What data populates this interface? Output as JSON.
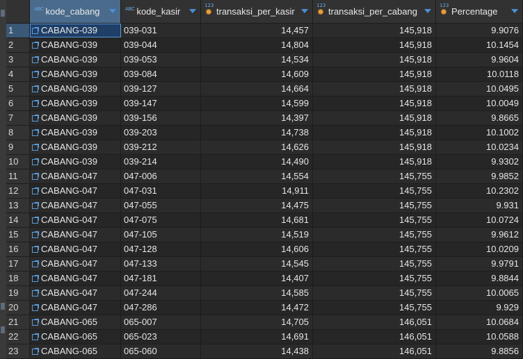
{
  "columns": [
    {
      "label": "kode_cabang",
      "type_icon": "abc-text-icon"
    },
    {
      "label": "kode_kasir",
      "type_icon": "abc-text-icon"
    },
    {
      "label": "transaksi_per_kasir",
      "type_icon": "123-number-icon"
    },
    {
      "label": "transaksi_per_cabang",
      "type_icon": "123-number-icon"
    },
    {
      "label": "Percentage",
      "type_icon": "123-number-icon"
    }
  ],
  "rows": [
    {
      "n": "1",
      "cabang": "CABANG-039",
      "kasir": "039-031",
      "tpk": "14,457",
      "tpc": "145,918",
      "pct": "9.9076"
    },
    {
      "n": "2",
      "cabang": "CABANG-039",
      "kasir": "039-044",
      "tpk": "14,804",
      "tpc": "145,918",
      "pct": "10.1454"
    },
    {
      "n": "3",
      "cabang": "CABANG-039",
      "kasir": "039-053",
      "tpk": "14,534",
      "tpc": "145,918",
      "pct": "9.9604"
    },
    {
      "n": "4",
      "cabang": "CABANG-039",
      "kasir": "039-084",
      "tpk": "14,609",
      "tpc": "145,918",
      "pct": "10.0118"
    },
    {
      "n": "5",
      "cabang": "CABANG-039",
      "kasir": "039-127",
      "tpk": "14,664",
      "tpc": "145,918",
      "pct": "10.0495"
    },
    {
      "n": "6",
      "cabang": "CABANG-039",
      "kasir": "039-147",
      "tpk": "14,599",
      "tpc": "145,918",
      "pct": "10.0049"
    },
    {
      "n": "7",
      "cabang": "CABANG-039",
      "kasir": "039-156",
      "tpk": "14,397",
      "tpc": "145,918",
      "pct": "9.8665"
    },
    {
      "n": "8",
      "cabang": "CABANG-039",
      "kasir": "039-203",
      "tpk": "14,738",
      "tpc": "145,918",
      "pct": "10.1002"
    },
    {
      "n": "9",
      "cabang": "CABANG-039",
      "kasir": "039-212",
      "tpk": "14,626",
      "tpc": "145,918",
      "pct": "10.0234"
    },
    {
      "n": "10",
      "cabang": "CABANG-039",
      "kasir": "039-214",
      "tpk": "14,490",
      "tpc": "145,918",
      "pct": "9.9302"
    },
    {
      "n": "11",
      "cabang": "CABANG-047",
      "kasir": "047-006",
      "tpk": "14,554",
      "tpc": "145,755",
      "pct": "9.9852"
    },
    {
      "n": "12",
      "cabang": "CABANG-047",
      "kasir": "047-031",
      "tpk": "14,911",
      "tpc": "145,755",
      "pct": "10.2302"
    },
    {
      "n": "13",
      "cabang": "CABANG-047",
      "kasir": "047-055",
      "tpk": "14,475",
      "tpc": "145,755",
      "pct": "9.931"
    },
    {
      "n": "14",
      "cabang": "CABANG-047",
      "kasir": "047-075",
      "tpk": "14,681",
      "tpc": "145,755",
      "pct": "10.0724"
    },
    {
      "n": "15",
      "cabang": "CABANG-047",
      "kasir": "047-105",
      "tpk": "14,519",
      "tpc": "145,755",
      "pct": "9.9612"
    },
    {
      "n": "16",
      "cabang": "CABANG-047",
      "kasir": "047-128",
      "tpk": "14,606",
      "tpc": "145,755",
      "pct": "10.0209"
    },
    {
      "n": "17",
      "cabang": "CABANG-047",
      "kasir": "047-133",
      "tpk": "14,545",
      "tpc": "145,755",
      "pct": "9.9791"
    },
    {
      "n": "18",
      "cabang": "CABANG-047",
      "kasir": "047-181",
      "tpk": "14,407",
      "tpc": "145,755",
      "pct": "9.8844"
    },
    {
      "n": "19",
      "cabang": "CABANG-047",
      "kasir": "047-244",
      "tpk": "14,585",
      "tpc": "145,755",
      "pct": "10.0065"
    },
    {
      "n": "20",
      "cabang": "CABANG-047",
      "kasir": "047-286",
      "tpk": "14,472",
      "tpc": "145,755",
      "pct": "9.929"
    },
    {
      "n": "21",
      "cabang": "CABANG-065",
      "kasir": "065-007",
      "tpk": "14,705",
      "tpc": "146,051",
      "pct": "10.0684"
    },
    {
      "n": "22",
      "cabang": "CABANG-065",
      "kasir": "065-023",
      "tpk": "14,691",
      "tpc": "146,051",
      "pct": "10.0588"
    },
    {
      "n": "23",
      "cabang": "CABANG-065",
      "kasir": "065-060",
      "tpk": "14,438",
      "tpc": "146,051",
      "pct": "9.8856"
    }
  ],
  "colors": {
    "background": "#2b2b2b",
    "header_selected": "#4a6b8c",
    "accent": "#4a90d9",
    "number_icon": "#e0a040"
  }
}
